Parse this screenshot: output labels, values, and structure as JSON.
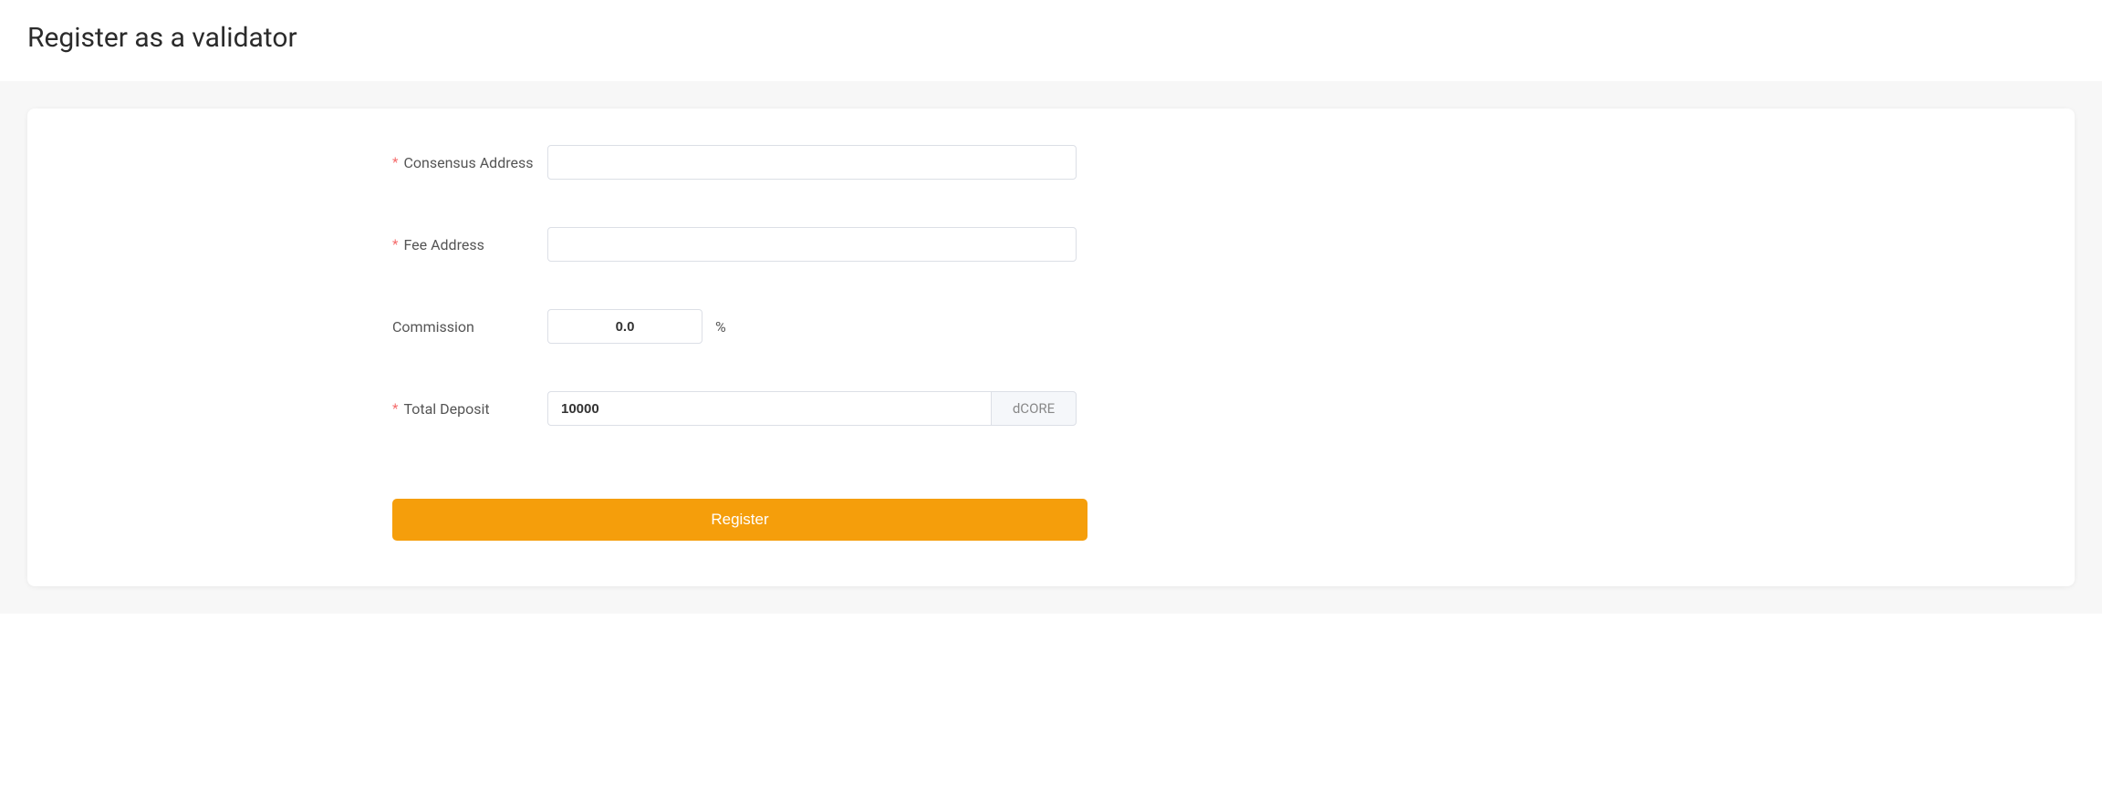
{
  "header": {
    "title": "Register as a validator"
  },
  "form": {
    "consensus_address": {
      "label": "Consensus Address",
      "value": "",
      "required": true
    },
    "fee_address": {
      "label": "Fee Address",
      "value": "",
      "required": true
    },
    "commission": {
      "label": "Commission",
      "value": "0.0",
      "suffix": "%",
      "required": false
    },
    "total_deposit": {
      "label": "Total Deposit",
      "value": "10000",
      "unit": "dCORE",
      "required": true
    }
  },
  "actions": {
    "register_label": "Register"
  },
  "required_marker": "*"
}
